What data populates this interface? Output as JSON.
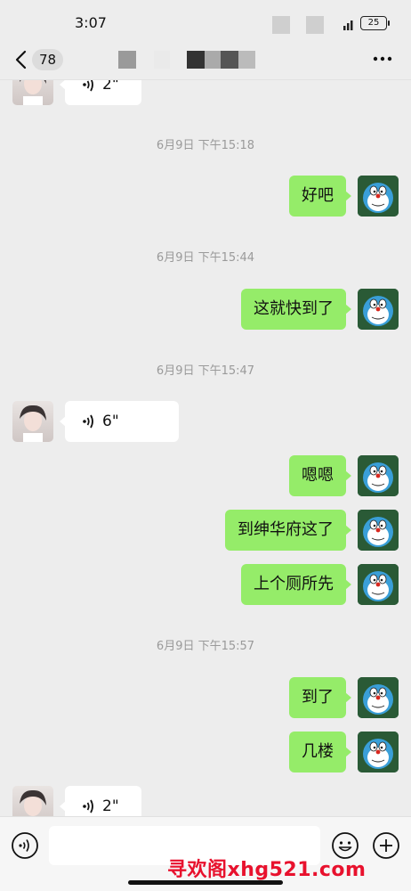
{
  "status_bar": {
    "time": "3:07",
    "battery": "25"
  },
  "nav": {
    "unread_count": "78"
  },
  "messages": [
    {
      "type": "voice",
      "side": "left",
      "duration": "2\""
    },
    {
      "type": "timestamp",
      "text": "6月9日 下午15:18"
    },
    {
      "type": "text",
      "side": "right",
      "text": "好吧"
    },
    {
      "type": "timestamp",
      "text": "6月9日 下午15:44"
    },
    {
      "type": "text",
      "side": "right",
      "text": "这就快到了"
    },
    {
      "type": "timestamp",
      "text": "6月9日 下午15:47"
    },
    {
      "type": "voice",
      "side": "left",
      "duration": "6\""
    },
    {
      "type": "text",
      "side": "right",
      "text": "嗯嗯"
    },
    {
      "type": "text",
      "side": "right",
      "text": "到绅华府这了"
    },
    {
      "type": "text",
      "side": "right",
      "text": "上个厕所先"
    },
    {
      "type": "timestamp",
      "text": "6月9日 下午15:57"
    },
    {
      "type": "text",
      "side": "right",
      "text": "到了"
    },
    {
      "type": "text",
      "side": "right",
      "text": "几楼"
    },
    {
      "type": "voice",
      "side": "left",
      "duration": "2\""
    }
  ],
  "input": {
    "value": ""
  },
  "watermark": "寻欢阁xhg521.com",
  "colors": {
    "bubble_right": "#95ec69",
    "background": "#ededed",
    "watermark": "#e8112d"
  },
  "icons": [
    "back-icon",
    "more-icon",
    "voice-icon",
    "emoji-icon",
    "plus-icon",
    "signal-icon",
    "battery-icon"
  ]
}
